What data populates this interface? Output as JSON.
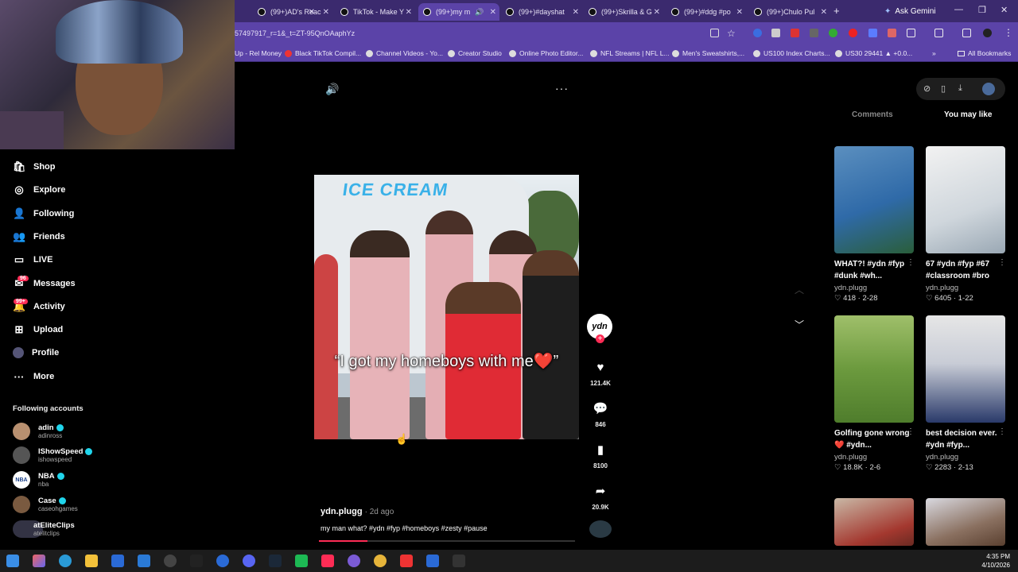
{
  "browser": {
    "tabs": [
      {
        "label": "(99+)AD's Reac"
      },
      {
        "label": "TikTok - Make Y"
      },
      {
        "label": "(99+)my m"
      },
      {
        "label": "(99+)#dayshat"
      },
      {
        "label": "(99+)Skrilla & G"
      },
      {
        "label": "(99+)#ddg #po"
      },
      {
        "label": "(99+)Chulo Pul"
      }
    ],
    "new_tab": "+",
    "gemini": "Ask Gemini",
    "url": "57497917_r=1&_t=ZT-95QnOAaphYz",
    "bookmarks": [
      {
        "label": "Up - Rel Money"
      },
      {
        "label": "Black TikTok Compil..."
      },
      {
        "label": "Channel Videos - Yo..."
      },
      {
        "label": "Creator Studio"
      },
      {
        "label": "Online Photo Editor..."
      },
      {
        "label": "NFL Streams | NFL L..."
      },
      {
        "label": "Men's Sweatshirts,..."
      },
      {
        "label": "US100 Index Charts..."
      },
      {
        "label": "US30 29441 ▲ +0.0..."
      }
    ],
    "all_bookmarks": "All Bookmarks"
  },
  "sidebar": {
    "items": [
      {
        "label": "Shop",
        "icon": "shop-icon"
      },
      {
        "label": "Explore",
        "icon": "explore-icon"
      },
      {
        "label": "Following",
        "icon": "following-icon"
      },
      {
        "label": "Friends",
        "icon": "friends-icon"
      },
      {
        "label": "LIVE",
        "icon": "live-icon"
      },
      {
        "label": "Messages",
        "icon": "messages-icon",
        "badge": "96"
      },
      {
        "label": "Activity",
        "icon": "activity-icon",
        "badge": "99+"
      },
      {
        "label": "Upload",
        "icon": "upload-icon"
      },
      {
        "label": "Profile",
        "icon": "profile-icon"
      },
      {
        "label": "More",
        "icon": "more-icon"
      }
    ],
    "following_title": "Following accounts",
    "accounts": [
      {
        "name": "adin",
        "handle": "adinross",
        "verified": true
      },
      {
        "name": "IShowSpeed",
        "handle": "ishowspeed",
        "verified": true
      },
      {
        "name": "NBA",
        "handle": "nba",
        "verified": true
      },
      {
        "name": "Case",
        "handle": "caseohgames",
        "verified": true
      },
      {
        "name": "atEliteClips",
        "handle": "atelitclips",
        "verified": false
      }
    ]
  },
  "video": {
    "banner": "ICE CREAM",
    "caption": "“I got my homeboys with me❤️”",
    "creator_initials": "ydn",
    "likes": "121.4K",
    "comments": "846",
    "saves": "8100",
    "shares": "20.9K",
    "author": "ydn.plugg",
    "ago": "· 2d ago",
    "description": "my man what? #ydn #fyp #homeboys #zesty #pause",
    "progress_fraction": 0.19
  },
  "right_panel": {
    "tab_comments": "Comments",
    "tab_you_may_like": "You may like",
    "items": [
      {
        "title": "WHAT?! #ydn #fyp #dunk #wh...",
        "user": "ydn.plugg",
        "likes": "418",
        "date": "2-28"
      },
      {
        "title": "67 #ydn #fyp #67 #classroom #bro",
        "user": "ydn.plugg",
        "likes": "6405",
        "date": "1-22"
      },
      {
        "title": "Golfing gone wrong❤️ #ydn...",
        "user": "ydn.plugg",
        "likes": "18.8K",
        "date": "2-6"
      },
      {
        "title": "best decision ever. #ydn #fyp...",
        "user": "ydn.plugg",
        "likes": "2283",
        "date": "2-13"
      }
    ]
  },
  "taskbar": {
    "time": "4:35 PM",
    "date": "4/10/2026"
  },
  "colors": {
    "accent": "#fe2c55",
    "chrome": "#5b43a8",
    "tabstrip": "#3b2a6e"
  }
}
